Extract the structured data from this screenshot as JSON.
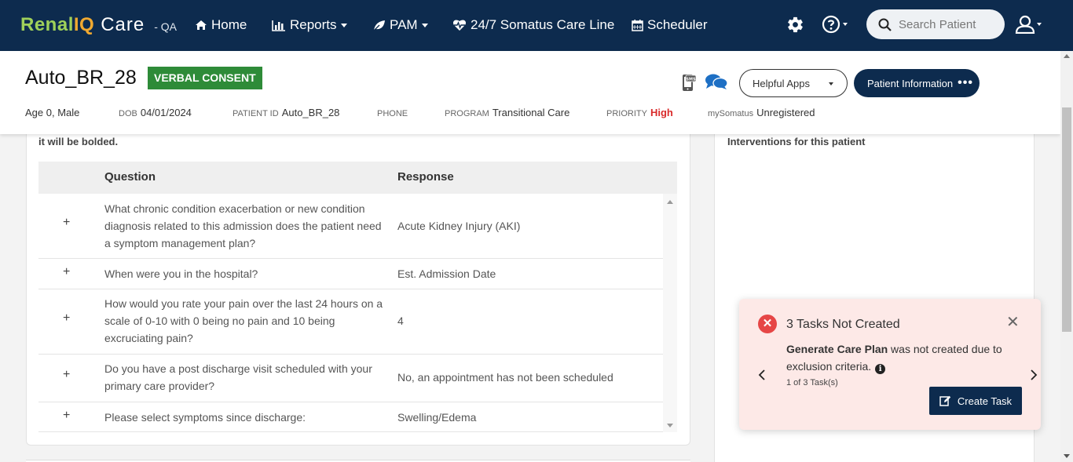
{
  "nav": {
    "brand_part1": "Renal",
    "brand_part2": "IQ",
    "brand_part3": "Care",
    "env": "- QA",
    "home": "Home",
    "reports": "Reports",
    "pam": "PAM",
    "care_line": "24/7 Somatus Care Line",
    "scheduler": "Scheduler",
    "search_placeholder": "Search Patient"
  },
  "patient": {
    "name": "Auto_BR_28",
    "consent_badge": "VERBAL CONSENT",
    "helpful_apps": "Helpful Apps",
    "patient_info": "Patient Information",
    "patient_info_dots": "•••",
    "age_sex": "Age 0, Male",
    "dob_label": "DOB",
    "dob": "04/01/2024",
    "pid_label": "PATIENT ID",
    "pid": "Auto_BR_28",
    "phone_label": "PHONE",
    "phone": "",
    "program_label": "PROGRAM",
    "program": "Transitional Care",
    "priority_label": "PRIORITY",
    "priority": "High",
    "mysomatus_label": "mySomatus",
    "mysomatus": "Unregistered"
  },
  "assessment": {
    "note": "it will be bolded.",
    "col_question": "Question",
    "col_response": "Response",
    "rows": [
      {
        "question": "What chronic condition exacerbation or new condition diagnosis related to this admission does the patient need a symptom management plan?",
        "response": "Acute Kidney Injury (AKI)"
      },
      {
        "question": "When were you in the hospital?",
        "response": "Est. Admission Date"
      },
      {
        "question": "How would you rate your pain over the last 24 hours on a scale of 0-10 with 0 being no pain and 10 being excruciating pain?",
        "response": "4"
      },
      {
        "question": "Do you have a post discharge visit scheduled with your primary care provider?",
        "response": "No, an appointment has not been scheduled"
      },
      {
        "question": "Please select symptoms since discharge:",
        "response": "Swelling/Edema"
      }
    ]
  },
  "interventions": {
    "title": "Interventions for this patient"
  },
  "toast": {
    "title": "3 Tasks Not Created",
    "task_name": "Generate Care Plan",
    "message": " was not created due to exclusion criteria.",
    "counter": "1 of 3 Task(s)",
    "create_button": "Create Task",
    "error_color": "#e64646"
  },
  "colors": {
    "navy": "#0d2b4e",
    "consent_green": "#2e8b38",
    "priority_red": "#d92b2b"
  }
}
